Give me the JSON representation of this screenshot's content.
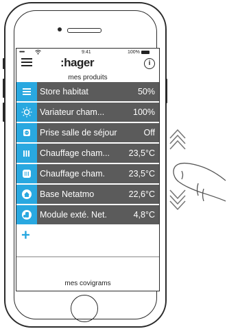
{
  "status": {
    "signal": "•••••",
    "time": "9:41",
    "battery": "100%"
  },
  "header": {
    "logo": ":hager",
    "subtitle": "mes produits"
  },
  "products": [
    {
      "label": "Store habitat",
      "value": "50%",
      "icon": "blinds-icon"
    },
    {
      "label": "Variateur cham...",
      "value": "100%",
      "icon": "dimmer-icon"
    },
    {
      "label": "Prise salle de séjour",
      "value": "Off",
      "icon": "socket-icon"
    },
    {
      "label": "Chauffage cham...",
      "value": "23,5°C",
      "icon": "radiator-icon"
    },
    {
      "label": "Chauffage cham.",
      "value": "23,5°C",
      "icon": "heater-icon"
    },
    {
      "label": "Base Netatmo",
      "value": "22,6°C",
      "icon": "home-station-icon"
    },
    {
      "label": "Module exté. Net.",
      "value": "4,8°C",
      "icon": "outdoor-module-icon"
    }
  ],
  "add_button": {
    "symbol": "+"
  },
  "footer": {
    "label": "mes covigrams"
  },
  "colors": {
    "accent": "#29a8e0",
    "row_bg": "#5b5b5b"
  }
}
